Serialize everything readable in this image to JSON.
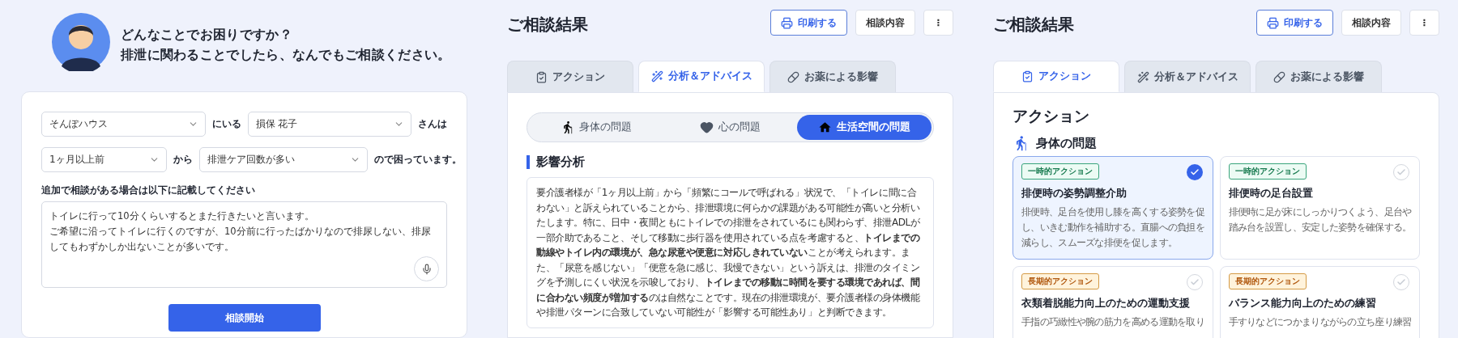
{
  "consult_form": {
    "greeting": [
      "どんなことでお困りですか？",
      "排泄に関わることでしたら、なんでもご相談ください。"
    ],
    "rows": [
      {
        "selects": [
          {
            "value": "そんぽハウス"
          },
          {
            "value": "損保 花子"
          }
        ],
        "connectors": [
          "にいる",
          "さんは"
        ]
      },
      {
        "selects": [
          {
            "value": "1ヶ月以上前"
          },
          {
            "value": "排泄ケア回数が多い"
          }
        ],
        "connectors": [
          "から",
          "ので困っています。"
        ]
      }
    ],
    "notes_label": "追加で相談がある場合は以下に記載してください",
    "notes_lines": [
      "トイレに行って10分くらいするとまた行きたいと言います。",
      "ご希望に沿ってトイレに行くのですが、10分前に行ったばかりなので排尿しない、排尿してもわずかしか出ないことが多いです。"
    ],
    "submit_button": "相談開始"
  },
  "results": [
    {
      "title": "ご相談結果",
      "buttons": [
        {
          "label": "印刷する",
          "kind": "primary"
        },
        {
          "label": "相談内容",
          "kind": "plain"
        },
        {
          "label": "⋮",
          "kind": "plain"
        }
      ],
      "tabs": [
        {
          "label": "アクション",
          "selected": false
        },
        {
          "label": "分析＆アドバイス",
          "selected": true
        },
        {
          "label": "お薬による影響",
          "selected": false
        }
      ],
      "content": {
        "kind": "analysis",
        "segments": [
          {
            "label": "身体の問題",
            "selected": false
          },
          {
            "label": "心の問題",
            "selected": false
          },
          {
            "label": "生活空間の問題",
            "selected": true
          }
        ],
        "section_title": "影響分析",
        "paragraph": "要介護者様が「1ヶ月以上前」から「頻繁にコールで呼ばれる」状況で、「トイレに間に合わない」と訴えられていることから、排泄環境に何らかの課題がある可能性が高いと分析いたします。特に、日中・夜間ともにトイレでの排泄をされているにも関わらず、排泄ADLが一部介助であること、そして移動に歩行器を使用されている点を考慮すると、**トイレまでの動線やトイレ内の環境が、急な尿意や便意に対応しきれていない**ことが考えられます。また、「尿意を感じない」「便意を急に感じ、我慢できない」という訴えは、排泄のタイミングを予測しにくい状況を示唆しており、**トイレまでの移動に時間を要する環境であれば、間に合わない頻度が増加する**のは自然なことです。現在の排泄環境が、要介護者様の身体機能や排泄パターンに合致していない可能性が「影響する可能性あり」と判断できます。"
      }
    },
    {
      "title": "ご相談結果",
      "buttons": [
        {
          "label": "印刷する",
          "kind": "primary"
        },
        {
          "label": "相談内容",
          "kind": "plain"
        },
        {
          "label": "⋮",
          "kind": "plain"
        }
      ],
      "tabs": [
        {
          "label": "アクション",
          "selected": true
        },
        {
          "label": "分析＆アドバイス",
          "selected": false
        },
        {
          "label": "お薬による影響",
          "selected": false
        }
      ],
      "content": {
        "kind": "actions",
        "heading": "アクション",
        "category": "身体の問題",
        "cards": [
          {
            "tag": "一時的アクション",
            "kind": "temporary",
            "title": "排便時の姿勢調整介助",
            "description": "排便時、足台を使用し膝を高くする姿勢を促し、いきむ動作を補助する。直腸への負担を減らし、スムーズな排便を促します。",
            "checked": true
          },
          {
            "tag": "一時的アクション",
            "kind": "temporary",
            "title": "排便時の足台設置",
            "description": "排便時に足が床にしっかりつくよう、足台や踏み台を設置し、安定した姿勢を確保する。",
            "checked": false
          },
          {
            "tag": "長期的アクション",
            "kind": "long_term",
            "title": "衣類着脱能力向上のための運動支援",
            "description": "手指の巧緻性や腕の筋力を高める運動を取り",
            "checked": false
          },
          {
            "tag": "長期的アクション",
            "kind": "long_term",
            "title": "バランス能力向上のための練習",
            "description": "手すりなどにつかまりながらの立ち座り練習",
            "checked": false
          }
        ]
      }
    }
  ]
}
